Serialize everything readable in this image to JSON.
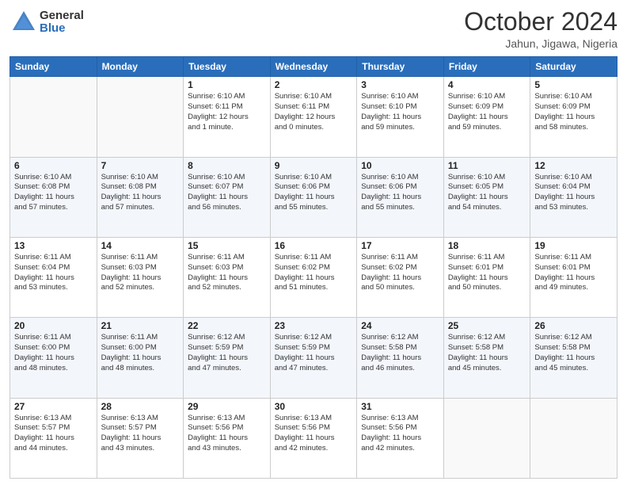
{
  "logo": {
    "general": "General",
    "blue": "Blue"
  },
  "header": {
    "month": "October 2024",
    "location": "Jahun, Jigawa, Nigeria"
  },
  "days_of_week": [
    "Sunday",
    "Monday",
    "Tuesday",
    "Wednesday",
    "Thursday",
    "Friday",
    "Saturday"
  ],
  "weeks": [
    [
      {
        "day": "",
        "info": ""
      },
      {
        "day": "",
        "info": ""
      },
      {
        "day": "1",
        "info": "Sunrise: 6:10 AM\nSunset: 6:11 PM\nDaylight: 12 hours\nand 1 minute."
      },
      {
        "day": "2",
        "info": "Sunrise: 6:10 AM\nSunset: 6:11 PM\nDaylight: 12 hours\nand 0 minutes."
      },
      {
        "day": "3",
        "info": "Sunrise: 6:10 AM\nSunset: 6:10 PM\nDaylight: 11 hours\nand 59 minutes."
      },
      {
        "day": "4",
        "info": "Sunrise: 6:10 AM\nSunset: 6:09 PM\nDaylight: 11 hours\nand 59 minutes."
      },
      {
        "day": "5",
        "info": "Sunrise: 6:10 AM\nSunset: 6:09 PM\nDaylight: 11 hours\nand 58 minutes."
      }
    ],
    [
      {
        "day": "6",
        "info": "Sunrise: 6:10 AM\nSunset: 6:08 PM\nDaylight: 11 hours\nand 57 minutes."
      },
      {
        "day": "7",
        "info": "Sunrise: 6:10 AM\nSunset: 6:08 PM\nDaylight: 11 hours\nand 57 minutes."
      },
      {
        "day": "8",
        "info": "Sunrise: 6:10 AM\nSunset: 6:07 PM\nDaylight: 11 hours\nand 56 minutes."
      },
      {
        "day": "9",
        "info": "Sunrise: 6:10 AM\nSunset: 6:06 PM\nDaylight: 11 hours\nand 55 minutes."
      },
      {
        "day": "10",
        "info": "Sunrise: 6:10 AM\nSunset: 6:06 PM\nDaylight: 11 hours\nand 55 minutes."
      },
      {
        "day": "11",
        "info": "Sunrise: 6:10 AM\nSunset: 6:05 PM\nDaylight: 11 hours\nand 54 minutes."
      },
      {
        "day": "12",
        "info": "Sunrise: 6:10 AM\nSunset: 6:04 PM\nDaylight: 11 hours\nand 53 minutes."
      }
    ],
    [
      {
        "day": "13",
        "info": "Sunrise: 6:11 AM\nSunset: 6:04 PM\nDaylight: 11 hours\nand 53 minutes."
      },
      {
        "day": "14",
        "info": "Sunrise: 6:11 AM\nSunset: 6:03 PM\nDaylight: 11 hours\nand 52 minutes."
      },
      {
        "day": "15",
        "info": "Sunrise: 6:11 AM\nSunset: 6:03 PM\nDaylight: 11 hours\nand 52 minutes."
      },
      {
        "day": "16",
        "info": "Sunrise: 6:11 AM\nSunset: 6:02 PM\nDaylight: 11 hours\nand 51 minutes."
      },
      {
        "day": "17",
        "info": "Sunrise: 6:11 AM\nSunset: 6:02 PM\nDaylight: 11 hours\nand 50 minutes."
      },
      {
        "day": "18",
        "info": "Sunrise: 6:11 AM\nSunset: 6:01 PM\nDaylight: 11 hours\nand 50 minutes."
      },
      {
        "day": "19",
        "info": "Sunrise: 6:11 AM\nSunset: 6:01 PM\nDaylight: 11 hours\nand 49 minutes."
      }
    ],
    [
      {
        "day": "20",
        "info": "Sunrise: 6:11 AM\nSunset: 6:00 PM\nDaylight: 11 hours\nand 48 minutes."
      },
      {
        "day": "21",
        "info": "Sunrise: 6:11 AM\nSunset: 6:00 PM\nDaylight: 11 hours\nand 48 minutes."
      },
      {
        "day": "22",
        "info": "Sunrise: 6:12 AM\nSunset: 5:59 PM\nDaylight: 11 hours\nand 47 minutes."
      },
      {
        "day": "23",
        "info": "Sunrise: 6:12 AM\nSunset: 5:59 PM\nDaylight: 11 hours\nand 47 minutes."
      },
      {
        "day": "24",
        "info": "Sunrise: 6:12 AM\nSunset: 5:58 PM\nDaylight: 11 hours\nand 46 minutes."
      },
      {
        "day": "25",
        "info": "Sunrise: 6:12 AM\nSunset: 5:58 PM\nDaylight: 11 hours\nand 45 minutes."
      },
      {
        "day": "26",
        "info": "Sunrise: 6:12 AM\nSunset: 5:58 PM\nDaylight: 11 hours\nand 45 minutes."
      }
    ],
    [
      {
        "day": "27",
        "info": "Sunrise: 6:13 AM\nSunset: 5:57 PM\nDaylight: 11 hours\nand 44 minutes."
      },
      {
        "day": "28",
        "info": "Sunrise: 6:13 AM\nSunset: 5:57 PM\nDaylight: 11 hours\nand 43 minutes."
      },
      {
        "day": "29",
        "info": "Sunrise: 6:13 AM\nSunset: 5:56 PM\nDaylight: 11 hours\nand 43 minutes."
      },
      {
        "day": "30",
        "info": "Sunrise: 6:13 AM\nSunset: 5:56 PM\nDaylight: 11 hours\nand 42 minutes."
      },
      {
        "day": "31",
        "info": "Sunrise: 6:13 AM\nSunset: 5:56 PM\nDaylight: 11 hours\nand 42 minutes."
      },
      {
        "day": "",
        "info": ""
      },
      {
        "day": "",
        "info": ""
      }
    ]
  ]
}
